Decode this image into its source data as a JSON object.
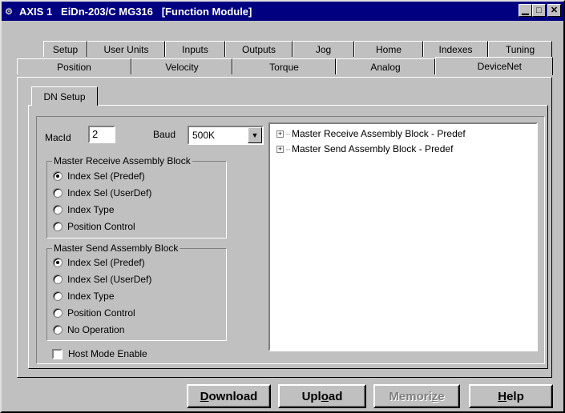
{
  "window": {
    "title": "AXIS 1   EiDn-203/C MG316   [Function Module]",
    "icon": "gear-icon",
    "minimize": "▁",
    "maximize": "□",
    "close": "✕"
  },
  "tabs_row1": [
    "Setup",
    "User Units",
    "Inputs",
    "Outputs",
    "Jog",
    "Home",
    "Indexes",
    "Tuning"
  ],
  "tabs_row2": [
    "Position",
    "Velocity",
    "Torque",
    "Analog",
    "DeviceNet"
  ],
  "active_tab": "DeviceNet",
  "subtab": "DN Setup",
  "macid": {
    "label": "MacId",
    "value": "2"
  },
  "baud": {
    "label": "Baud",
    "value": "500K"
  },
  "receive_group": {
    "title": "Master Receive Assembly Block",
    "options": [
      "Index Sel (Predef)",
      "Index Sel (UserDef)",
      "Index Type",
      "Position Control"
    ],
    "selected": 0
  },
  "send_group": {
    "title": "Master Send Assembly Block",
    "options": [
      "Index Sel (Predef)",
      "Index Sel (UserDef)",
      "Index Type",
      "Position Control",
      "No Operation"
    ],
    "selected": 0
  },
  "host_mode": {
    "label": "Host Mode Enable",
    "checked": false
  },
  "tree": [
    "Master Receive Assembly Block - Predef",
    "Master Send Assembly Block - Predef"
  ],
  "buttons": {
    "download": {
      "hot": "D",
      "rest": "ownload"
    },
    "upload": {
      "pre": "Upl",
      "hot": "o",
      "rest": "ad"
    },
    "memorize": {
      "pre": "Memori",
      "hot": "z",
      "rest": "e"
    },
    "help": {
      "hot": "H",
      "rest": "elp"
    }
  }
}
